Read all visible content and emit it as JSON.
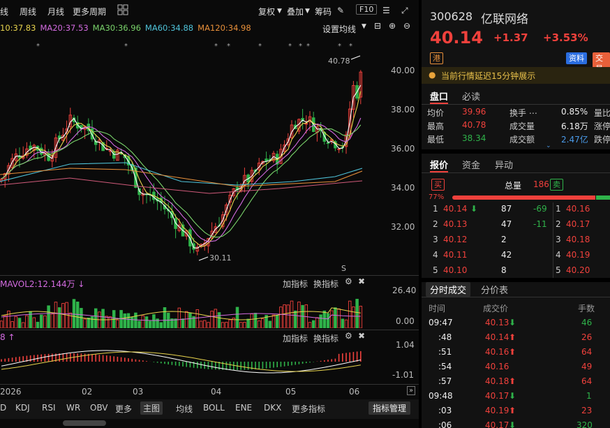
{
  "toolbar": {
    "tab_current": "线",
    "week": "周线",
    "month": "月线",
    "more_period": "更多周期",
    "adjust": "复权",
    "overlay": "叠加",
    "chips": "筹码",
    "f10": "F10"
  },
  "ma": {
    "ma10": "10:37.83",
    "ma20": "MA20:37.53",
    "ma30": "MA30:36.96",
    "ma60": "MA60:34.88",
    "ma120": "MA120:34.98",
    "settings": "设置均线"
  },
  "price_axis": [
    "40.00",
    "38.00",
    "36.00",
    "34.00",
    "32.00"
  ],
  "annotations": {
    "high": "40.78",
    "low": "30.11",
    "s_mark": "S"
  },
  "vol": {
    "title": "MAVOL2:12.144万",
    "add": "加指标",
    "swap": "换指标",
    "ax_top": "26.40",
    "ax_bottom": "0.00"
  },
  "macd": {
    "title": "8",
    "add": "加指标",
    "swap": "换指标",
    "ax_top": "1.04",
    "ax_bottom": "-1.01"
  },
  "x_axis": [
    "2026",
    "02",
    "03",
    "04",
    "05",
    "06"
  ],
  "bottom": {
    "i0": "D",
    "i1": "KDJ",
    "i2": "RSI",
    "i3": "WR",
    "i4": "OBV",
    "i5": "更多",
    "main": "主图",
    "ma": "均线",
    "boll": "BOLL",
    "ene": "ENE",
    "dkx": "DKX",
    "more_ind": "更多指标",
    "manage": "指标管理"
  },
  "colors": {
    "up": "#f0413c",
    "down": "#2fb34a",
    "ma5": "#ffffff",
    "ma10": "#e8d44d",
    "ma20": "#d36be0",
    "ma30": "#7ad36b",
    "ma60": "#4fc3d9",
    "ma120": "#e8903a"
  },
  "stock": {
    "code": "300628",
    "name": "亿联网络",
    "price": "40.14",
    "change": "+1.37",
    "pct": "+3.53%",
    "hk": "港",
    "info_btn": "资料",
    "trade_btn": "交易",
    "delay_notice": "当前行情延迟15分钟展示"
  },
  "tabs1": {
    "a": "盘口",
    "b": "必读"
  },
  "stats": [
    {
      "l1": "均价",
      "v1": "39.96",
      "l2": "换手",
      "v2": "0.85%",
      "l3": "量比"
    },
    {
      "l1": "最高",
      "v1": "40.78",
      "l2": "成交量",
      "v2": "6.18万",
      "l3": "涨停"
    },
    {
      "l1": "最低",
      "v1": "38.34",
      "l2": "成交额",
      "v2": "2.47亿",
      "l3": "跌停"
    }
  ],
  "tabs2": {
    "a": "报价",
    "b": "资金",
    "c": "异动"
  },
  "ob": {
    "vol_label": "总量",
    "vol": "186",
    "buy": "买",
    "sell": "卖",
    "pct": "77%"
  },
  "bids": [
    {
      "n": "1",
      "p": "40.14",
      "q": "87",
      "d": "-69"
    },
    {
      "n": "2",
      "p": "40.13",
      "q": "47",
      "d": "-11"
    },
    {
      "n": "3",
      "p": "40.12",
      "q": "2",
      "d": ""
    },
    {
      "n": "4",
      "p": "40.11",
      "q": "42",
      "d": ""
    },
    {
      "n": "5",
      "p": "40.10",
      "q": "8",
      "d": ""
    }
  ],
  "asks": [
    {
      "n": "1",
      "p": "40.16"
    },
    {
      "n": "2",
      "p": "40.17"
    },
    {
      "n": "3",
      "p": "40.18"
    },
    {
      "n": "4",
      "p": "40.19"
    },
    {
      "n": "5",
      "p": "40.20"
    }
  ],
  "tabs3": {
    "a": "分时成交",
    "b": "分价表"
  },
  "trades_head": {
    "t": "时间",
    "p": "成交价",
    "q": "手数"
  },
  "trades": [
    {
      "t": "09:47",
      "p": "40.13",
      "dir": "down",
      "q": "46"
    },
    {
      "t": ":48",
      "p": "40.14",
      "dir": "up",
      "q": "26"
    },
    {
      "t": ":51",
      "p": "40.16",
      "dir": "up",
      "q": "64"
    },
    {
      "t": ":54",
      "p": "40.16",
      "dir": "",
      "q": "49"
    },
    {
      "t": ":57",
      "p": "40.18",
      "dir": "up",
      "q": "64"
    },
    {
      "t": "09:48",
      "p": "40.17",
      "dir": "down",
      "q": "1"
    },
    {
      "t": ":03",
      "p": "40.19",
      "dir": "up",
      "q": "23"
    },
    {
      "t": ":06",
      "p": "40.17",
      "dir": "down",
      "q": "320"
    }
  ]
}
